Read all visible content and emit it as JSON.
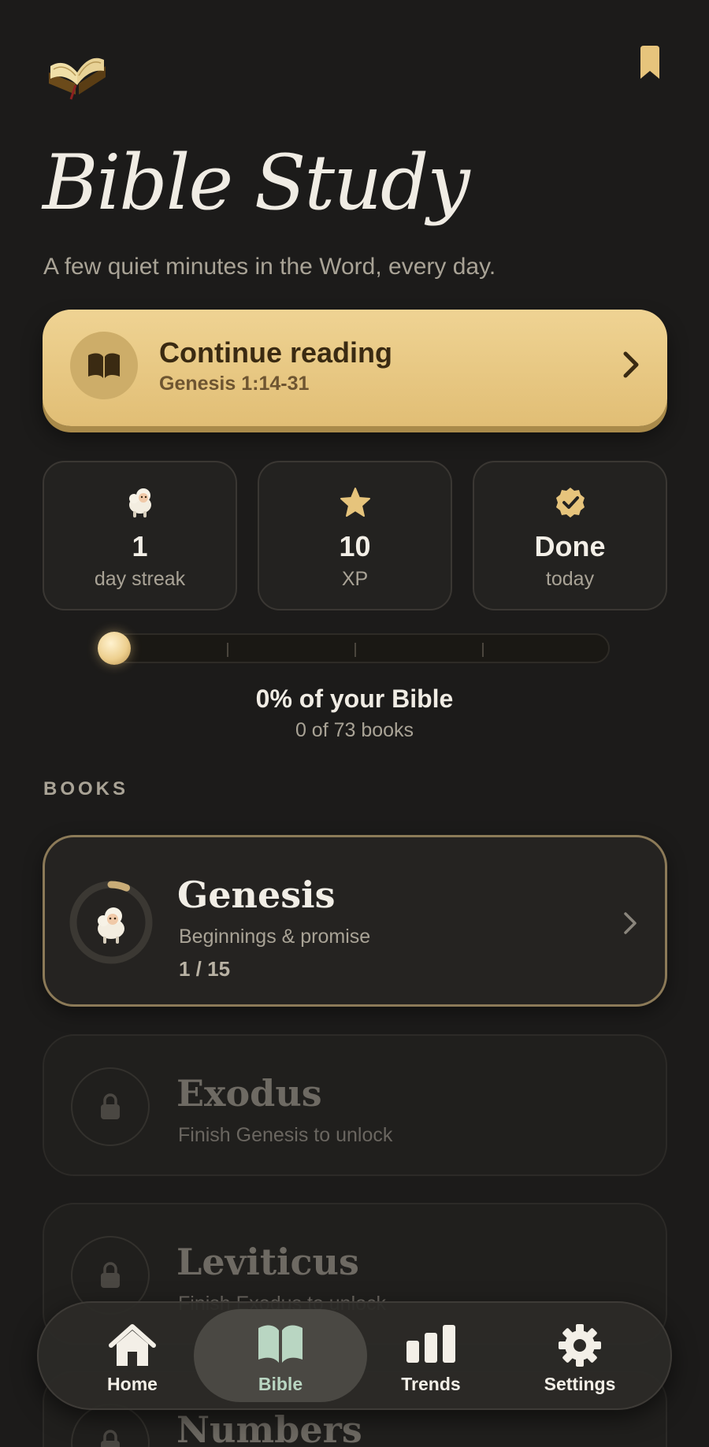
{
  "header": {
    "logo_icon": "open-bible-icon",
    "bookmark_icon": "bookmark-icon",
    "title": "Bible Study",
    "subtitle": "A few quiet minutes in the Word, every day."
  },
  "continue": {
    "title": "Continue reading",
    "reference": "Genesis 1:14-31",
    "icon": "book-icon"
  },
  "stats": [
    {
      "icon": "lamb-icon",
      "value": "1",
      "label": "day streak"
    },
    {
      "icon": "star-icon",
      "value": "10",
      "label": "XP"
    },
    {
      "icon": "verified-badge-icon",
      "value": "Done",
      "label": "today"
    }
  ],
  "progress": {
    "fraction": 0,
    "percent_text": "0% of your Bible",
    "books_text": "0 of 73 books"
  },
  "books_section": {
    "label": "BOOKS",
    "items": [
      {
        "title": "Genesis",
        "subtitle": "Beginnings & promise",
        "count": "1 / 15",
        "progress": 0.0667,
        "locked": false
      },
      {
        "title": "Exodus",
        "subtitle": "Finish Genesis to unlock",
        "locked": true
      },
      {
        "title": "Leviticus",
        "subtitle": "Finish Exodus to unlock",
        "locked": true
      },
      {
        "title": "Numbers",
        "locked": true
      }
    ]
  },
  "tabbar": {
    "tabs": [
      {
        "label": "Home",
        "icon": "home-icon"
      },
      {
        "label": "Bible",
        "icon": "open-book-icon",
        "selected": true
      },
      {
        "label": "Trends",
        "icon": "bar-chart-icon"
      },
      {
        "label": "Settings",
        "icon": "gear-icon"
      }
    ]
  },
  "colors": {
    "background": "#1c1b1a",
    "accent_gold": "#e6c47c",
    "selected_tab_text": "#b9d6c2"
  }
}
